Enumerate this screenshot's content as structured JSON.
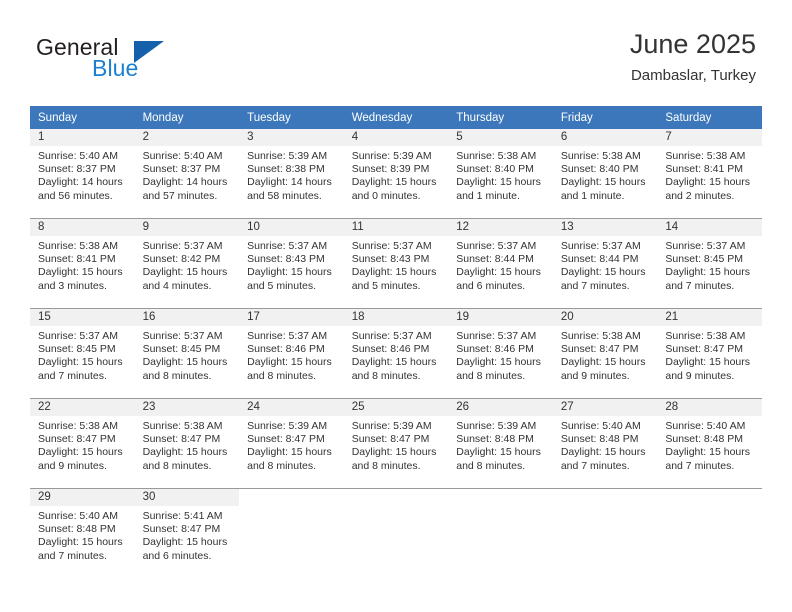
{
  "brand": {
    "name_part1": "General",
    "name_part2": "Blue",
    "triangle_icon": "triangle-icon",
    "color_dark": "#231f20",
    "color_blue": "#1c7fd0",
    "color_triangle": "#1560ab"
  },
  "header": {
    "title": "June 2025",
    "subtitle": "Dambaslar, Turkey"
  },
  "theme": {
    "header_background": "#3b77ba",
    "header_text": "#ffffff",
    "daynum_band": "#f1f1f1",
    "grid_line": "#9a9a9a",
    "body_text": "#333333"
  },
  "weekdays": [
    "Sunday",
    "Monday",
    "Tuesday",
    "Wednesday",
    "Thursday",
    "Friday",
    "Saturday"
  ],
  "weeks": [
    [
      {
        "day": "1",
        "sunrise": "Sunrise: 5:40 AM",
        "sunset": "Sunset: 8:37 PM",
        "daylight1": "Daylight: 14 hours",
        "daylight2": "and 56 minutes."
      },
      {
        "day": "2",
        "sunrise": "Sunrise: 5:40 AM",
        "sunset": "Sunset: 8:37 PM",
        "daylight1": "Daylight: 14 hours",
        "daylight2": "and 57 minutes."
      },
      {
        "day": "3",
        "sunrise": "Sunrise: 5:39 AM",
        "sunset": "Sunset: 8:38 PM",
        "daylight1": "Daylight: 14 hours",
        "daylight2": "and 58 minutes."
      },
      {
        "day": "4",
        "sunrise": "Sunrise: 5:39 AM",
        "sunset": "Sunset: 8:39 PM",
        "daylight1": "Daylight: 15 hours",
        "daylight2": "and 0 minutes."
      },
      {
        "day": "5",
        "sunrise": "Sunrise: 5:38 AM",
        "sunset": "Sunset: 8:40 PM",
        "daylight1": "Daylight: 15 hours",
        "daylight2": "and 1 minute."
      },
      {
        "day": "6",
        "sunrise": "Sunrise: 5:38 AM",
        "sunset": "Sunset: 8:40 PM",
        "daylight1": "Daylight: 15 hours",
        "daylight2": "and 1 minute."
      },
      {
        "day": "7",
        "sunrise": "Sunrise: 5:38 AM",
        "sunset": "Sunset: 8:41 PM",
        "daylight1": "Daylight: 15 hours",
        "daylight2": "and 2 minutes."
      }
    ],
    [
      {
        "day": "8",
        "sunrise": "Sunrise: 5:38 AM",
        "sunset": "Sunset: 8:41 PM",
        "daylight1": "Daylight: 15 hours",
        "daylight2": "and 3 minutes."
      },
      {
        "day": "9",
        "sunrise": "Sunrise: 5:37 AM",
        "sunset": "Sunset: 8:42 PM",
        "daylight1": "Daylight: 15 hours",
        "daylight2": "and 4 minutes."
      },
      {
        "day": "10",
        "sunrise": "Sunrise: 5:37 AM",
        "sunset": "Sunset: 8:43 PM",
        "daylight1": "Daylight: 15 hours",
        "daylight2": "and 5 minutes."
      },
      {
        "day": "11",
        "sunrise": "Sunrise: 5:37 AM",
        "sunset": "Sunset: 8:43 PM",
        "daylight1": "Daylight: 15 hours",
        "daylight2": "and 5 minutes."
      },
      {
        "day": "12",
        "sunrise": "Sunrise: 5:37 AM",
        "sunset": "Sunset: 8:44 PM",
        "daylight1": "Daylight: 15 hours",
        "daylight2": "and 6 minutes."
      },
      {
        "day": "13",
        "sunrise": "Sunrise: 5:37 AM",
        "sunset": "Sunset: 8:44 PM",
        "daylight1": "Daylight: 15 hours",
        "daylight2": "and 7 minutes."
      },
      {
        "day": "14",
        "sunrise": "Sunrise: 5:37 AM",
        "sunset": "Sunset: 8:45 PM",
        "daylight1": "Daylight: 15 hours",
        "daylight2": "and 7 minutes."
      }
    ],
    [
      {
        "day": "15",
        "sunrise": "Sunrise: 5:37 AM",
        "sunset": "Sunset: 8:45 PM",
        "daylight1": "Daylight: 15 hours",
        "daylight2": "and 7 minutes."
      },
      {
        "day": "16",
        "sunrise": "Sunrise: 5:37 AM",
        "sunset": "Sunset: 8:45 PM",
        "daylight1": "Daylight: 15 hours",
        "daylight2": "and 8 minutes."
      },
      {
        "day": "17",
        "sunrise": "Sunrise: 5:37 AM",
        "sunset": "Sunset: 8:46 PM",
        "daylight1": "Daylight: 15 hours",
        "daylight2": "and 8 minutes."
      },
      {
        "day": "18",
        "sunrise": "Sunrise: 5:37 AM",
        "sunset": "Sunset: 8:46 PM",
        "daylight1": "Daylight: 15 hours",
        "daylight2": "and 8 minutes."
      },
      {
        "day": "19",
        "sunrise": "Sunrise: 5:37 AM",
        "sunset": "Sunset: 8:46 PM",
        "daylight1": "Daylight: 15 hours",
        "daylight2": "and 8 minutes."
      },
      {
        "day": "20",
        "sunrise": "Sunrise: 5:38 AM",
        "sunset": "Sunset: 8:47 PM",
        "daylight1": "Daylight: 15 hours",
        "daylight2": "and 9 minutes."
      },
      {
        "day": "21",
        "sunrise": "Sunrise: 5:38 AM",
        "sunset": "Sunset: 8:47 PM",
        "daylight1": "Daylight: 15 hours",
        "daylight2": "and 9 minutes."
      }
    ],
    [
      {
        "day": "22",
        "sunrise": "Sunrise: 5:38 AM",
        "sunset": "Sunset: 8:47 PM",
        "daylight1": "Daylight: 15 hours",
        "daylight2": "and 9 minutes."
      },
      {
        "day": "23",
        "sunrise": "Sunrise: 5:38 AM",
        "sunset": "Sunset: 8:47 PM",
        "daylight1": "Daylight: 15 hours",
        "daylight2": "and 8 minutes."
      },
      {
        "day": "24",
        "sunrise": "Sunrise: 5:39 AM",
        "sunset": "Sunset: 8:47 PM",
        "daylight1": "Daylight: 15 hours",
        "daylight2": "and 8 minutes."
      },
      {
        "day": "25",
        "sunrise": "Sunrise: 5:39 AM",
        "sunset": "Sunset: 8:47 PM",
        "daylight1": "Daylight: 15 hours",
        "daylight2": "and 8 minutes."
      },
      {
        "day": "26",
        "sunrise": "Sunrise: 5:39 AM",
        "sunset": "Sunset: 8:48 PM",
        "daylight1": "Daylight: 15 hours",
        "daylight2": "and 8 minutes."
      },
      {
        "day": "27",
        "sunrise": "Sunrise: 5:40 AM",
        "sunset": "Sunset: 8:48 PM",
        "daylight1": "Daylight: 15 hours",
        "daylight2": "and 7 minutes."
      },
      {
        "day": "28",
        "sunrise": "Sunrise: 5:40 AM",
        "sunset": "Sunset: 8:48 PM",
        "daylight1": "Daylight: 15 hours",
        "daylight2": "and 7 minutes."
      }
    ],
    [
      {
        "day": "29",
        "sunrise": "Sunrise: 5:40 AM",
        "sunset": "Sunset: 8:48 PM",
        "daylight1": "Daylight: 15 hours",
        "daylight2": "and 7 minutes."
      },
      {
        "day": "30",
        "sunrise": "Sunrise: 5:41 AM",
        "sunset": "Sunset: 8:47 PM",
        "daylight1": "Daylight: 15 hours",
        "daylight2": "and 6 minutes."
      },
      null,
      null,
      null,
      null,
      null
    ]
  ]
}
